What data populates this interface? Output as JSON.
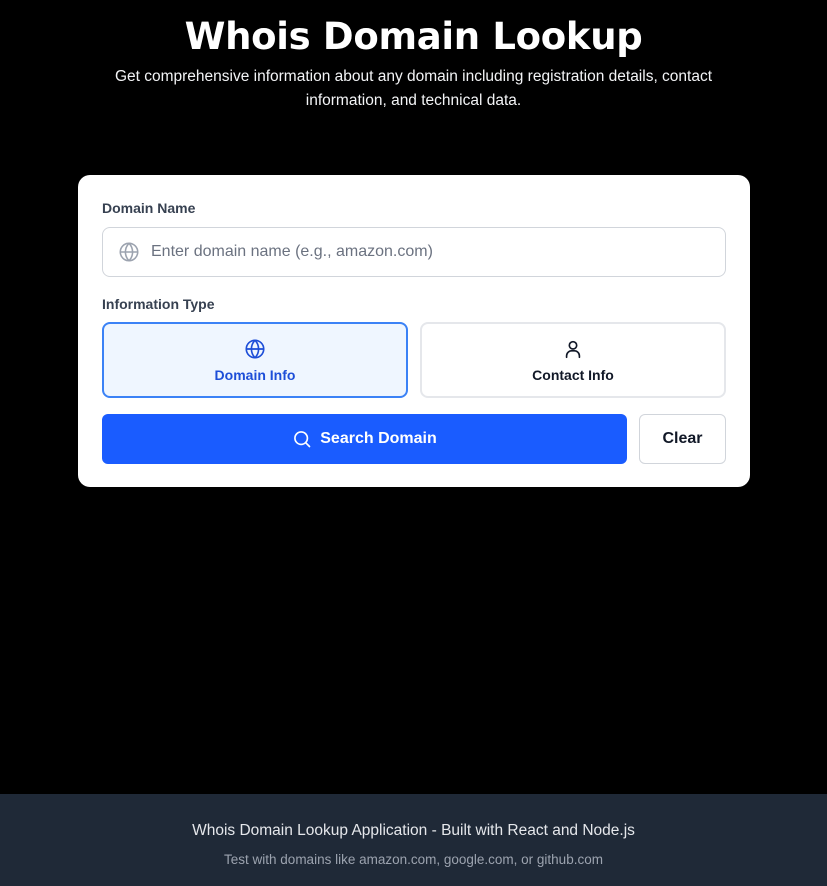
{
  "header": {
    "title": "Whois Domain Lookup",
    "subtitle": "Get comprehensive information about any domain including registration details, contact information, and technical data."
  },
  "form": {
    "domain_label": "Domain Name",
    "domain_placeholder": "Enter domain name (e.g., amazon.com)",
    "domain_value": "",
    "type_label": "Information Type",
    "types": [
      {
        "label": "Domain Info",
        "icon": "globe-icon",
        "selected": true
      },
      {
        "label": "Contact Info",
        "icon": "user-icon",
        "selected": false
      }
    ],
    "search_label": "Search Domain",
    "clear_label": "Clear"
  },
  "footer": {
    "line1": "Whois Domain Lookup Application - Built with React and Node.js",
    "line2": "Test with domains like amazon.com, google.com, or github.com"
  },
  "colors": {
    "background": "#000000",
    "primary": "#1a5cff",
    "selected_border": "#3b82f6",
    "selected_bg": "#eff6ff",
    "footer_bg": "#1f2937"
  }
}
